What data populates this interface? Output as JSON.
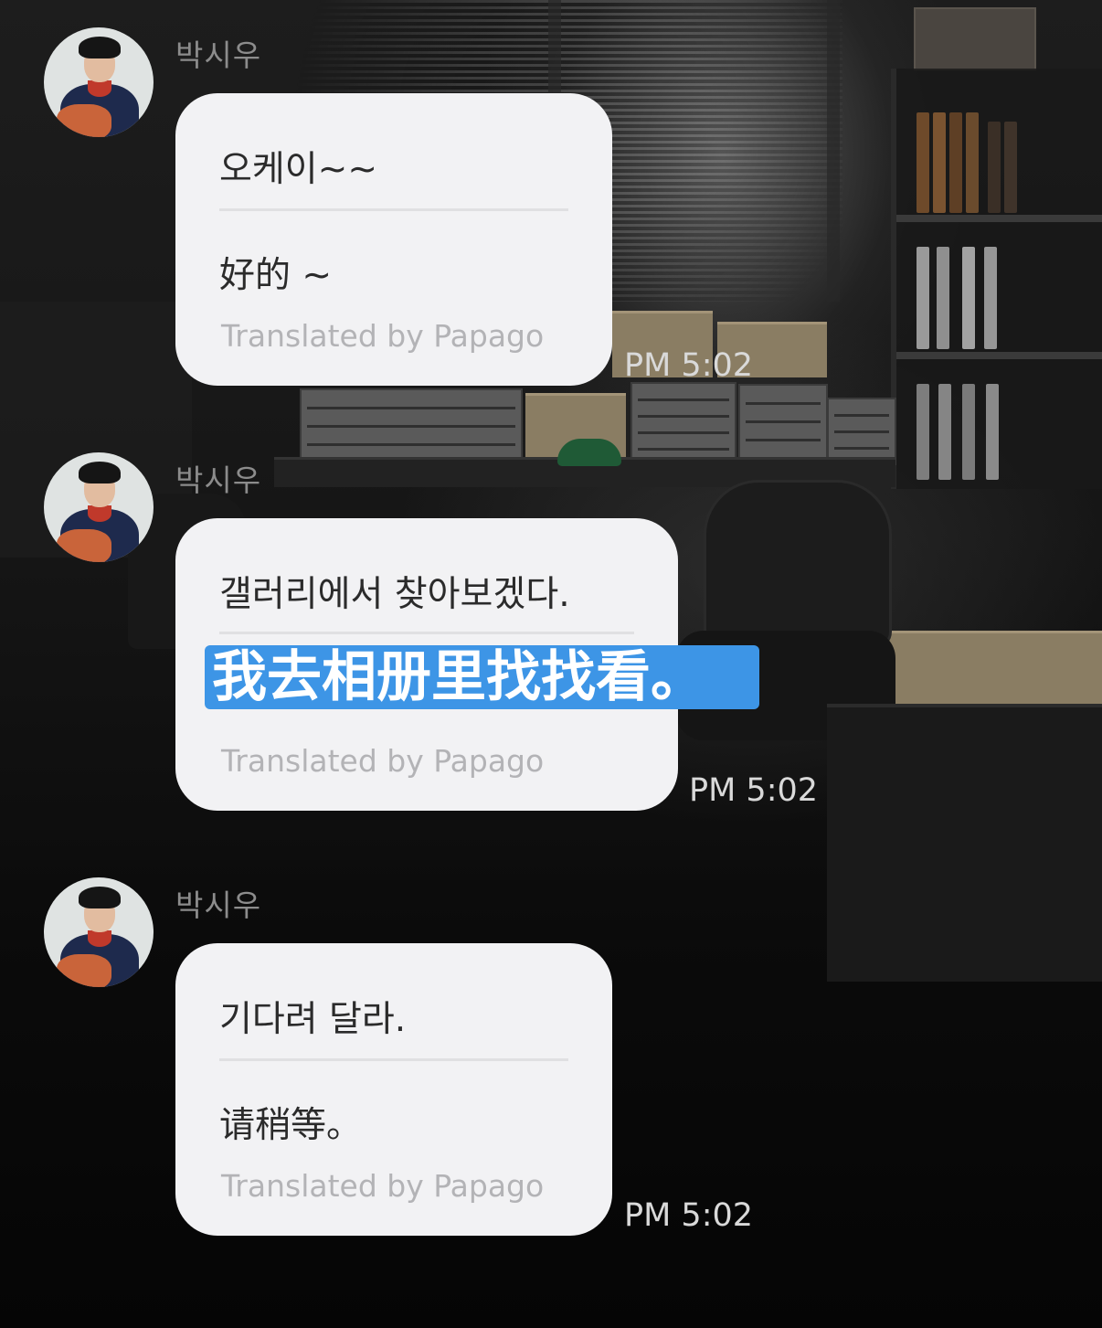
{
  "messages": [
    {
      "sender": "박시우",
      "original": "오케이~~",
      "translated": "好的 ~",
      "credit": "Translated by Papago",
      "time": "PM 5:02"
    },
    {
      "sender": "박시우",
      "original": "갤러리에서 찾아보겠다.",
      "translated": "我去相册里找找看。",
      "credit": "Translated by Papago",
      "time": "PM 5:02",
      "selected": true
    },
    {
      "sender": "박시우",
      "original": "기다려 달라.",
      "translated": "请稍等。",
      "credit": "Translated by Papago",
      "time": "PM 5:02"
    }
  ],
  "colors": {
    "bubble": "#f2f2f4",
    "selection": "#3d95e6",
    "sender": "#8c8c8c",
    "time": "#d9d9d9",
    "credit": "#b3b3b6"
  },
  "icons": {
    "avatar": "profile-photo-icon"
  }
}
